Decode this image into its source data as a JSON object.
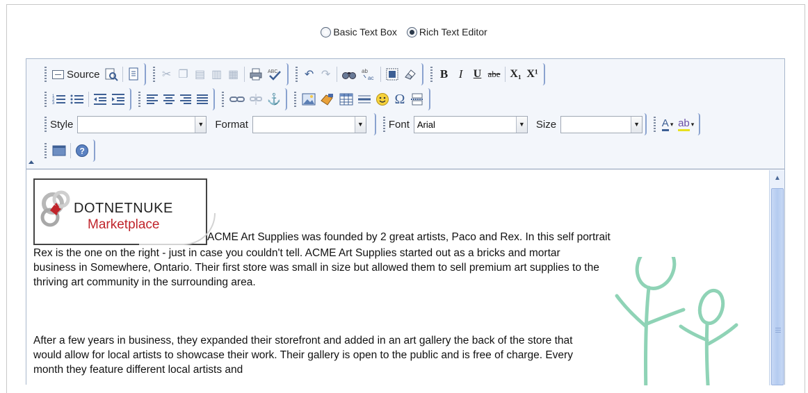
{
  "mode_switch": {
    "basic_label": "Basic Text Box",
    "rich_label": "Rich Text Editor",
    "selected": "rich"
  },
  "toolbar": {
    "source_label": "Source",
    "style_label": "Style",
    "style_value": "",
    "format_label": "Format",
    "format_value": "",
    "font_label": "Font",
    "font_value": "Arial",
    "size_label": "Size",
    "size_value": "",
    "bold_label": "B",
    "italic_label": "I",
    "underline_label": "U",
    "strike_label": "abe",
    "subscript_label": "X₁",
    "superscript_label": "X¹",
    "text_color_label": "A",
    "bg_color_label": "ab"
  },
  "content": {
    "logo_text": "DOTNETNUKE",
    "logo_sub": "Marketplace",
    "para1_first": "ACME Art Supplies was founded by 2 great artists, Paco and Rex.  In this self portrait",
    "para1_rest": "Rex is the one on the right - just in case you couldn't tell.  ACME Art Supplies started out as a bricks and mortar business in Somewhere, Ontario.  Their first store was small in size but allowed them to sell premium art supplies to the thriving art community in the surrounding area.",
    "para2": "After a few years in business, they expanded their storefront and added in an art gallery the back of the store that would allow for local artists to showcase their work.  Their gallery is open to the public and is free of charge.  Every month they feature different local artists and"
  },
  "colors": {
    "toolbar_bg": "#f3f6fb",
    "icon_blue": "#3d5f94",
    "logo_red": "#c0242b",
    "figure_green": "#8fd3b6"
  }
}
